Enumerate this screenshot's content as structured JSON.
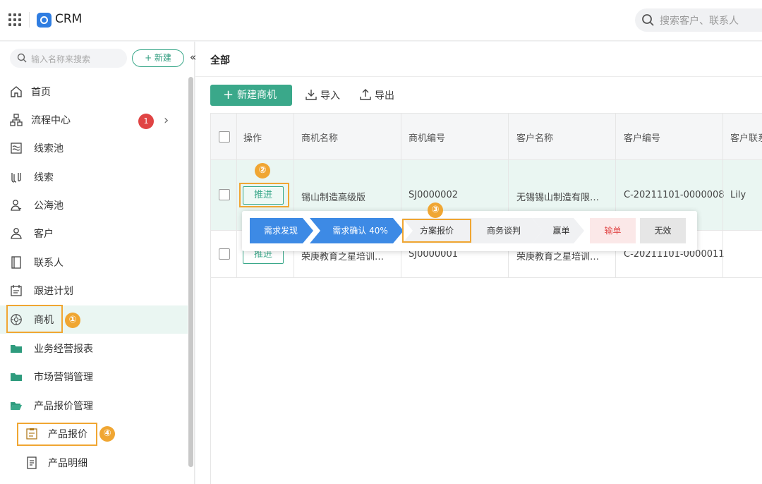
{
  "app": {
    "title": "CRM"
  },
  "top_search": {
    "placeholder": "搜索客户、联系人"
  },
  "sidebar": {
    "search_placeholder": "输入名称来搜索",
    "new_label": "+ 新建",
    "collapse_label": "«",
    "items": [
      {
        "label": "首页",
        "icon": "home-icon"
      },
      {
        "label": "流程中心",
        "icon": "flow-icon",
        "badge": "1"
      },
      {
        "label": "线索池",
        "icon": "lead-pool-icon"
      },
      {
        "label": "线索",
        "icon": "lead-icon"
      },
      {
        "label": "公海池",
        "icon": "public-pool-icon"
      },
      {
        "label": "客户",
        "icon": "customer-icon"
      },
      {
        "label": "联系人",
        "icon": "contact-icon"
      },
      {
        "label": "跟进计划",
        "icon": "plan-icon"
      },
      {
        "label": "商机",
        "icon": "opportunity-icon",
        "active": true
      },
      {
        "label": "业务经营报表",
        "icon": "folder-icon"
      },
      {
        "label": "市场营销管理",
        "icon": "folder-icon"
      },
      {
        "label": "产品报价管理",
        "icon": "folder-open-icon"
      },
      {
        "label": "产品报价",
        "icon": "quote-icon"
      },
      {
        "label": "产品明细",
        "icon": "detail-icon"
      }
    ]
  },
  "annotations": [
    "①",
    "②",
    "③",
    "④"
  ],
  "main": {
    "title": "全部",
    "create_label": "新建商机",
    "import_label": "导入",
    "export_label": "导出",
    "columns": [
      "操作",
      "商机名称",
      "商机编号",
      "客户名称",
      "客户编号",
      "客户联系"
    ],
    "rows": [
      {
        "action": "推进",
        "name": "锡山制造高级版",
        "code": "SJ0000002",
        "customer": "无锡锡山制造有限…",
        "customer_code": "C-20211101-0000008",
        "contact": "Lily"
      },
      {
        "action": "推进",
        "name": "荣庚教育之星培训…",
        "code": "SJ0000001",
        "customer": "荣庚教育之星培训…",
        "customer_code": "C-20211101-0000011",
        "contact": ""
      }
    ]
  },
  "stages": [
    "需求发现",
    "需求确认 40%",
    "方案报价",
    "商务谈判",
    "赢单",
    "输单",
    "无效"
  ],
  "colors": {
    "accent": "#3aa88a",
    "stage_blue": "#3d8ae5",
    "highlight": "#f0a632",
    "lost": "#e24c4c"
  }
}
